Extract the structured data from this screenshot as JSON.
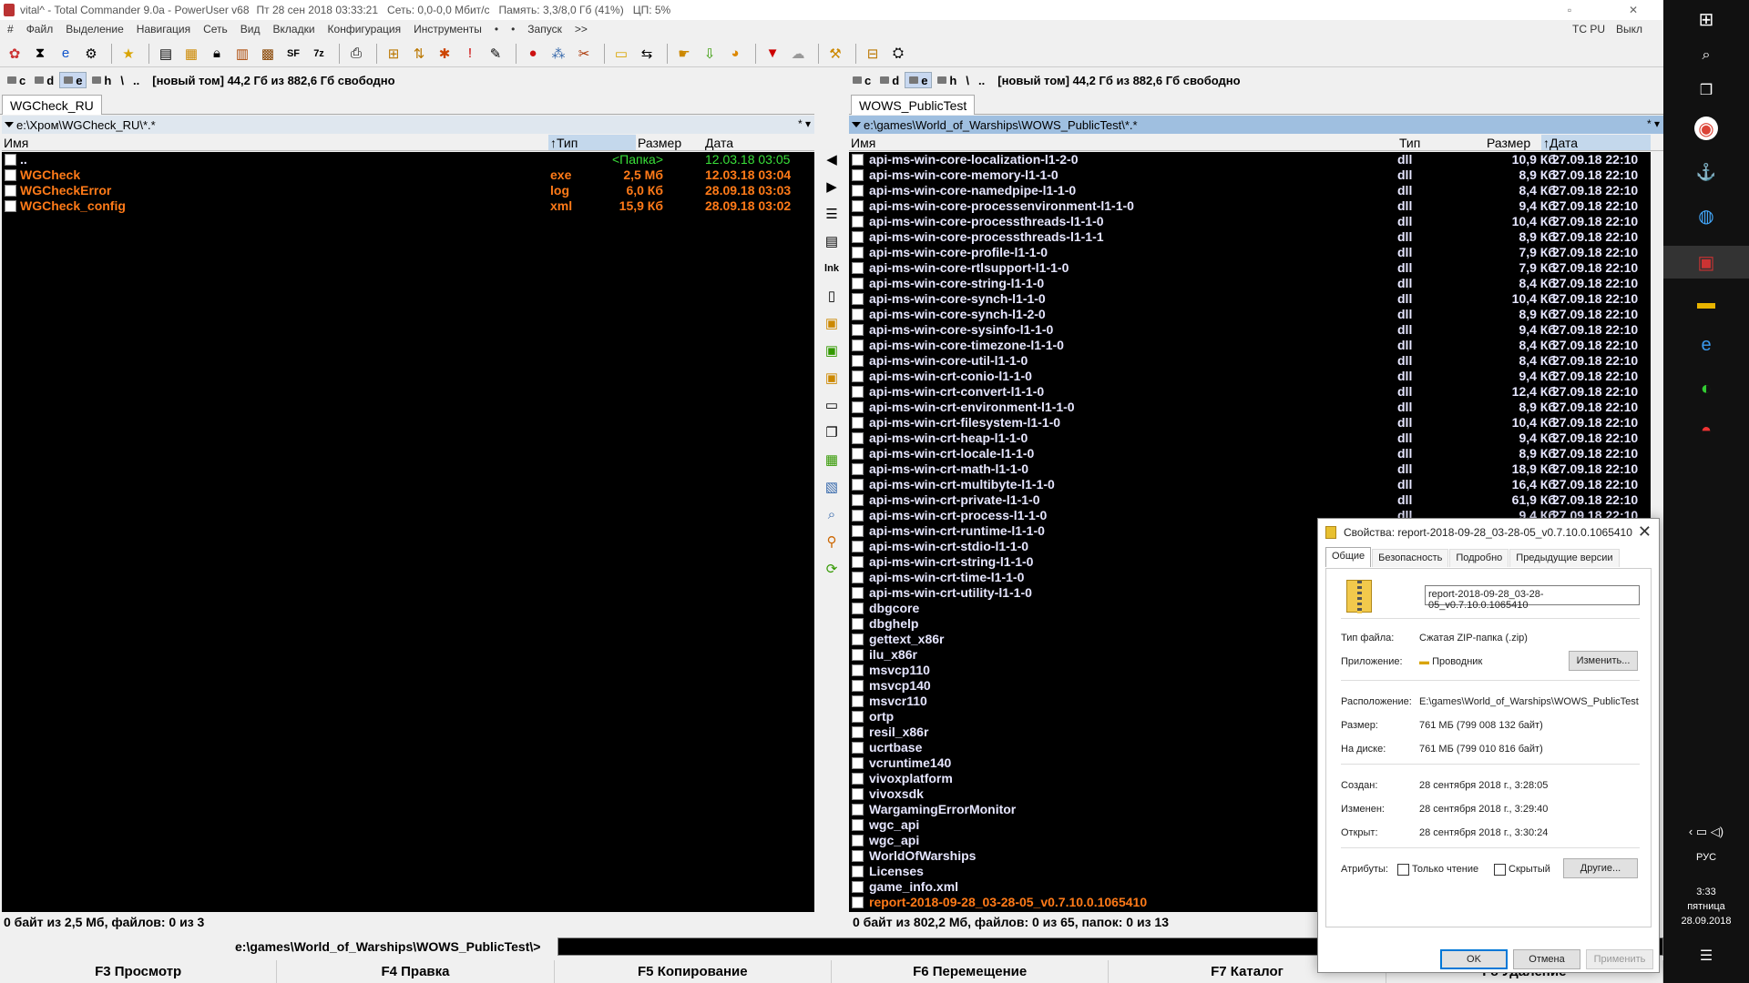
{
  "window": {
    "title": "vital^ - Total Commander 9.0a - PowerUser v68",
    "clock": "Пт 28 сен 2018   03:33:21",
    "net": "Сеть: 0,0-0,0 Мбит/с",
    "mem": "Память: 3,3/8,0 Гб (41%)",
    "cpu": "ЦП: 5%",
    "restore_glyph": "▫",
    "close_glyph": "✕"
  },
  "menu": {
    "hash": "#",
    "items": [
      "Файл",
      "Выделение",
      "Навигация",
      "Сеть",
      "Вид",
      "Вкладки",
      "Конфигурация",
      "Инструменты",
      "•",
      "•",
      "Запуск",
      ">>"
    ],
    "tcpu": "TC PU",
    "exit": "Выкл"
  },
  "left": {
    "drives": [
      "c",
      "d",
      "e",
      "h",
      "\\",
      ".."
    ],
    "drive_info": "[новый том]  44,2 Гб из 882,6 Гб свободно",
    "tab": "WGCheck_RU",
    "path": "e:\\Хром\\WGCheck_RU\\*.*",
    "path_right": "* ▾",
    "headers": {
      "name": "Имя",
      "type": "Тип",
      "size": "Размер",
      "date": "Дата"
    },
    "files": [
      {
        "name": "..",
        "type": "",
        "size": "<Папка>",
        "date": "12.03.18 03:05",
        "color": "up"
      },
      {
        "name": "WGCheck",
        "type": "exe",
        "size": "2,5 Мб",
        "date": "12.03.18 03:04",
        "color": "orange"
      },
      {
        "name": "WGCheckError",
        "type": "log",
        "size": "6,0 Кб",
        "date": "28.09.18 03:03",
        "color": "orange"
      },
      {
        "name": "WGCheck_config",
        "type": "xml",
        "size": "15,9 Кб",
        "date": "28.09.18 03:02",
        "color": "orange"
      }
    ],
    "status": "0 байт из 2,5 Мб, файлов: 0 из 3"
  },
  "right": {
    "drives": [
      "c",
      "d",
      "e",
      "h",
      "\\",
      ".."
    ],
    "drive_info": "[новый том]  44,2 Гб из 882,6 Гб свободно",
    "tab": "WOWS_PublicTest",
    "path": "e:\\games\\World_of_Warships\\WOWS_PublicTest\\*.*",
    "path_right": "* ▾",
    "headers": {
      "name": "Имя",
      "type": "Тип",
      "size": "Размер",
      "date": "Дата"
    },
    "files": [
      {
        "name": "api-ms-win-core-localization-l1-2-0",
        "type": "dll",
        "size": "10,9 Кб",
        "date": "27.09.18 22:10"
      },
      {
        "name": "api-ms-win-core-memory-l1-1-0",
        "type": "dll",
        "size": "8,9 Кб",
        "date": "27.09.18 22:10"
      },
      {
        "name": "api-ms-win-core-namedpipe-l1-1-0",
        "type": "dll",
        "size": "8,4 Кб",
        "date": "27.09.18 22:10"
      },
      {
        "name": "api-ms-win-core-processenvironment-l1-1-0",
        "type": "dll",
        "size": "9,4 Кб",
        "date": "27.09.18 22:10"
      },
      {
        "name": "api-ms-win-core-processthreads-l1-1-0",
        "type": "dll",
        "size": "10,4 Кб",
        "date": "27.09.18 22:10"
      },
      {
        "name": "api-ms-win-core-processthreads-l1-1-1",
        "type": "dll",
        "size": "8,9 Кб",
        "date": "27.09.18 22:10"
      },
      {
        "name": "api-ms-win-core-profile-l1-1-0",
        "type": "dll",
        "size": "7,9 Кб",
        "date": "27.09.18 22:10"
      },
      {
        "name": "api-ms-win-core-rtlsupport-l1-1-0",
        "type": "dll",
        "size": "7,9 Кб",
        "date": "27.09.18 22:10"
      },
      {
        "name": "api-ms-win-core-string-l1-1-0",
        "type": "dll",
        "size": "8,4 Кб",
        "date": "27.09.18 22:10"
      },
      {
        "name": "api-ms-win-core-synch-l1-1-0",
        "type": "dll",
        "size": "10,4 Кб",
        "date": "27.09.18 22:10"
      },
      {
        "name": "api-ms-win-core-synch-l1-2-0",
        "type": "dll",
        "size": "8,9 Кб",
        "date": "27.09.18 22:10"
      },
      {
        "name": "api-ms-win-core-sysinfo-l1-1-0",
        "type": "dll",
        "size": "9,4 Кб",
        "date": "27.09.18 22:10"
      },
      {
        "name": "api-ms-win-core-timezone-l1-1-0",
        "type": "dll",
        "size": "8,4 Кб",
        "date": "27.09.18 22:10"
      },
      {
        "name": "api-ms-win-core-util-l1-1-0",
        "type": "dll",
        "size": "8,4 Кб",
        "date": "27.09.18 22:10"
      },
      {
        "name": "api-ms-win-crt-conio-l1-1-0",
        "type": "dll",
        "size": "9,4 Кб",
        "date": "27.09.18 22:10"
      },
      {
        "name": "api-ms-win-crt-convert-l1-1-0",
        "type": "dll",
        "size": "12,4 Кб",
        "date": "27.09.18 22:10"
      },
      {
        "name": "api-ms-win-crt-environment-l1-1-0",
        "type": "dll",
        "size": "8,9 Кб",
        "date": "27.09.18 22:10"
      },
      {
        "name": "api-ms-win-crt-filesystem-l1-1-0",
        "type": "dll",
        "size": "10,4 Кб",
        "date": "27.09.18 22:10"
      },
      {
        "name": "api-ms-win-crt-heap-l1-1-0",
        "type": "dll",
        "size": "9,4 Кб",
        "date": "27.09.18 22:10"
      },
      {
        "name": "api-ms-win-crt-locale-l1-1-0",
        "type": "dll",
        "size": "8,9 Кб",
        "date": "27.09.18 22:10"
      },
      {
        "name": "api-ms-win-crt-math-l1-1-0",
        "type": "dll",
        "size": "18,9 Кб",
        "date": "27.09.18 22:10"
      },
      {
        "name": "api-ms-win-crt-multibyte-l1-1-0",
        "type": "dll",
        "size": "16,4 Кб",
        "date": "27.09.18 22:10"
      },
      {
        "name": "api-ms-win-crt-private-l1-1-0",
        "type": "dll",
        "size": "61,9 Кб",
        "date": "27.09.18 22:10"
      },
      {
        "name": "api-ms-win-crt-process-l1-1-0",
        "type": "dll",
        "size": "9,4 Кб",
        "date": "27.09.18 22:10"
      },
      {
        "name": "api-ms-win-crt-runtime-l1-1-0",
        "type": "",
        "size": "",
        "date": ""
      },
      {
        "name": "api-ms-win-crt-stdio-l1-1-0",
        "type": "",
        "size": "",
        "date": ""
      },
      {
        "name": "api-ms-win-crt-string-l1-1-0",
        "type": "",
        "size": "",
        "date": ""
      },
      {
        "name": "api-ms-win-crt-time-l1-1-0",
        "type": "",
        "size": "",
        "date": ""
      },
      {
        "name": "api-ms-win-crt-utility-l1-1-0",
        "type": "",
        "size": "",
        "date": ""
      },
      {
        "name": "dbgcore",
        "type": "",
        "size": "",
        "date": ""
      },
      {
        "name": "dbghelp",
        "type": "",
        "size": "",
        "date": ""
      },
      {
        "name": "gettext_x86r",
        "type": "",
        "size": "",
        "date": ""
      },
      {
        "name": "ilu_x86r",
        "type": "",
        "size": "",
        "date": ""
      },
      {
        "name": "msvcp110",
        "type": "",
        "size": "",
        "date": ""
      },
      {
        "name": "msvcp140",
        "type": "",
        "size": "",
        "date": ""
      },
      {
        "name": "msvcr110",
        "type": "",
        "size": "",
        "date": ""
      },
      {
        "name": "ortp",
        "type": "",
        "size": "",
        "date": ""
      },
      {
        "name": "resil_x86r",
        "type": "",
        "size": "",
        "date": ""
      },
      {
        "name": "ucrtbase",
        "type": "",
        "size": "",
        "date": ""
      },
      {
        "name": "vcruntime140",
        "type": "",
        "size": "",
        "date": ""
      },
      {
        "name": "vivoxplatform",
        "type": "",
        "size": "",
        "date": ""
      },
      {
        "name": "vivoxsdk",
        "type": "",
        "size": "",
        "date": ""
      },
      {
        "name": "WargamingErrorMonitor",
        "type": "",
        "size": "",
        "date": ""
      },
      {
        "name": "wgc_api",
        "type": "",
        "size": "",
        "date": ""
      },
      {
        "name": "wgc_api",
        "type": "",
        "size": "",
        "date": ""
      },
      {
        "name": "WorldOfWarships",
        "type": "",
        "size": "",
        "date": ""
      },
      {
        "name": "Licenses",
        "type": "",
        "size": "",
        "date": ""
      },
      {
        "name": "game_info.xml",
        "type": "",
        "size": "",
        "date": ""
      },
      {
        "name": "report-2018-09-28_03-28-05_v0.7.10.0.1065410",
        "type": "",
        "size": "",
        "date": "",
        "color": "orange"
      }
    ],
    "status": "0 байт из 802,2 Мб, файлов: 0 из 65, папок: 0 из 13"
  },
  "cmdline": {
    "label": "e:\\games\\World_of_Warships\\WOWS_PublicTest\\>"
  },
  "fkeys": [
    "F3 Просмотр",
    "F4 Правка",
    "F5 Копирование",
    "F6 Перемещение",
    "F7 Каталог",
    "F8 Удаление"
  ],
  "dialog": {
    "title": "Свойства: report-2018-09-28_03-28-05_v0.7.10.0.1065410",
    "tabs": [
      "Общие",
      "Безопасность",
      "Подробно",
      "Предыдущие версии"
    ],
    "filename": "report-2018-09-28_03-28-05_v0.7.10.0.1065410",
    "type_label": "Тип файла:",
    "type_value": "Сжатая ZIP-папка (.zip)",
    "app_label": "Приложение:",
    "app_value": "Проводник",
    "change_button": "Изменить...",
    "location_label": "Расположение:",
    "location_value": "E:\\games\\World_of_Warships\\WOWS_PublicTest",
    "size_label": "Размер:",
    "size_value": "761 МБ (799 008 132 байт)",
    "disk_label": "На диске:",
    "disk_value": "761 МБ (799 010 816 байт)",
    "created_label": "Создан:",
    "created_value": "28 сентября 2018 г., 3:28:05",
    "modified_label": "Изменен:",
    "modified_value": "28 сентября 2018 г., 3:29:40",
    "opened_label": "Открыт:",
    "opened_value": "28 сентября 2018 г., 3:30:24",
    "attr_label": "Атрибуты:",
    "readonly_label": "Только чтение",
    "hidden_label": "Скрытый",
    "other_button": "Другие...",
    "ok": "OK",
    "cancel": "Отмена",
    "apply": "Применить"
  },
  "taskbar": {
    "lang": "РУС",
    "time": "3:33",
    "day": "пятница",
    "date": "28.09.2018"
  }
}
